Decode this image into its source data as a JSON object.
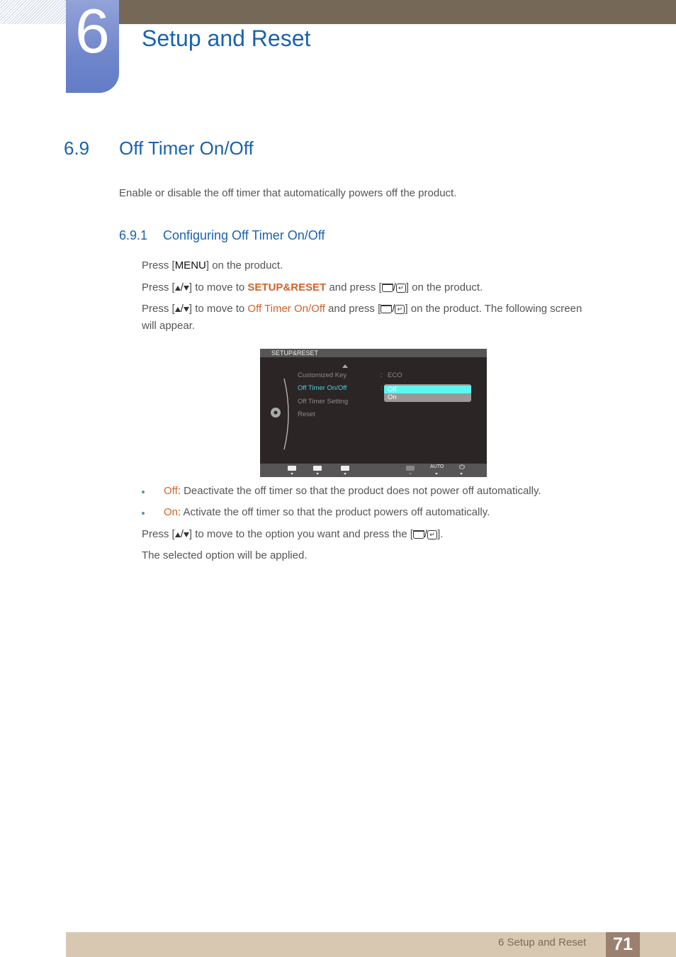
{
  "chapter": {
    "number": "6",
    "title": "Setup and Reset"
  },
  "section": {
    "number": "6.9",
    "title": "Off Timer On/Off",
    "intro": "Enable or disable the off timer that automatically powers off the product."
  },
  "subsection": {
    "number": "6.9.1",
    "title": "Configuring Off Timer On/Off"
  },
  "steps": {
    "s1_pre": "Press [",
    "s1_key": "MENU",
    "s1_post": "] on the product.",
    "s2_pre": "Press [",
    "s2_mid": "] to move to ",
    "s2_hl": "SETUP&RESET",
    "s2_mid2": " and press [",
    "s2_post": "] on the product.",
    "s3_pre": "Press [",
    "s3_mid": "] to move to ",
    "s3_hl": "Off Timer On/Off",
    "s3_mid2": " and press [",
    "s3_post": "] on the product. The following screen",
    "s3_line2": "will appear."
  },
  "osd": {
    "header": "SETUP&RESET",
    "menu_items": [
      {
        "label": "Customized Key",
        "value": "ECO"
      },
      {
        "label": "Off Timer On/Off",
        "active": true
      },
      {
        "label": "Off Timer Setting"
      },
      {
        "label": "Reset"
      }
    ],
    "options": [
      {
        "label": "Off",
        "selected": true
      },
      {
        "label": "On",
        "selected": false
      }
    ],
    "footer_auto": "AUTO",
    "colors": {
      "active": "#3fd6df",
      "selected_option": "#5cf7ef"
    }
  },
  "bullets": [
    {
      "term": "Off",
      "text": ": Deactivate the off timer so that the product does not power off automatically."
    },
    {
      "term": "On",
      "text": ": Activate the off timer so that the product powers off automatically."
    }
  ],
  "after": {
    "s4_pre": "Press [",
    "s4_mid": "] to move to the option you want and press the [",
    "s4_post": "].",
    "s5": "The selected option will be applied."
  },
  "footer": {
    "text": "6 Setup and Reset",
    "page": "71"
  },
  "colors": {
    "heading_blue": "#1a63ae",
    "highlight_orange": "#d2622a",
    "top_bar": "#766856",
    "footer_bar": "#d8c8b2",
    "page_box": "#9b7f6f"
  }
}
